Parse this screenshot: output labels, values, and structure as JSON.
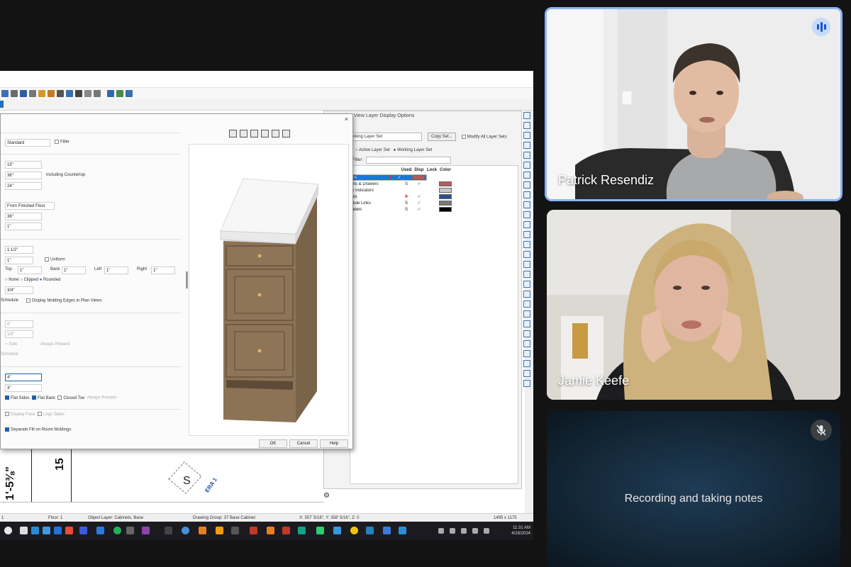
{
  "cabinet_dialog": {
    "close_glyph": "×",
    "rows": {
      "type_value": "Standard",
      "filler_label": "Filler",
      "width_value": "15\"",
      "height_value": "36\"",
      "height_label": "Including Countertop",
      "depth_value": "24\"",
      "floor_ref_value": "From Finished Floor",
      "f1_value": "36\"",
      "f2_value": "1\"",
      "toe_value": "1 1/2\"",
      "thick_value": "1\"",
      "unibox_label": "Uniform",
      "top_label": "Top",
      "top_value": "1\"",
      "back_label": "Back",
      "back_value": "1\"",
      "left_label": "Left",
      "left_value": "1\"",
      "right_label": "Right",
      "right_value": "1\"",
      "corner_none": "None",
      "corner_clipped": "Clipped",
      "corner_rounded": "Rounded",
      "radius_value": "3/4\"",
      "schedule_label": "Schedule",
      "molding_label": "Display Molding Edges in Plan Views",
      "g1_value": "0\"",
      "g2_value": "1/2\"",
      "side_label": "Side",
      "always_label": "Always Present",
      "schedule2_label": "Schedule",
      "h1_value": "4\"",
      "h2_value": "3\"",
      "flat_sides": "Flat Sides",
      "flat_back": "Flat Back",
      "closed_toe": "Closed Toe",
      "always2": "Always Present",
      "cb_face": "Display Face",
      "cb_legs": "Legs Sides",
      "separate": "Separate Fill on Room Moldings"
    },
    "buttons": {
      "ok": "OK",
      "cancel": "Cancel",
      "help": "Help"
    }
  },
  "layer_dialog": {
    "title": "Plan View Layer Display Options",
    "layer_set": "Working Layer Set",
    "copy_set": "Copy Set...",
    "modify_all": "Modify All Layer Sets",
    "active_set": "Active Layer Set",
    "working_set": "Working Layer Set",
    "filter_label": "Filter:",
    "columns": {
      "used": "Used",
      "disp": "Disp",
      "lock": "Lock",
      "color": "Color"
    },
    "rows": [
      {
        "name": "ls",
        "used": "✚",
        "disp": "✓",
        "color": "#b05a5a",
        "selected": true
      },
      {
        "name": "ets & Drawers",
        "used": "S",
        "disp": "✓",
        "color": "#b06060",
        "selected": false
      },
      {
        "name": "e Indicators",
        "used": "",
        "disp": "",
        "color": "#c8c8c8",
        "selected": false
      },
      {
        "name": "als",
        "used": "✚",
        "disp": "✓",
        "color": "#2a4f8a",
        "selected": false
      },
      {
        "name": "dule Links",
        "used": "S",
        "disp": "✓",
        "color": "#7a7a7a",
        "selected": false
      },
      {
        "name": "abels",
        "used": "S",
        "disp": "✓",
        "color": "#000000",
        "selected": false
      }
    ]
  },
  "plan": {
    "dimension": "1'-5⅜\"",
    "dimension2": "15",
    "symbol": "S",
    "tag": "ERA 1"
  },
  "status_bar": {
    "left": "1",
    "floor": "Floor: 1",
    "object": "Object Layer: Cabinets,  Base",
    "group": "Drawing Group: 37   Base Cabinet",
    "coords": "X: 357' 5/16\", Y: 358' 5/16\", Z: 0",
    "size": "1495 x 1175"
  },
  "taskbar": {
    "time": "11:31 AM",
    "date": "4/28/2024"
  },
  "participants": [
    {
      "name": "Patrick Resendiz",
      "speaking": true
    },
    {
      "name": "Jamie Keefe",
      "speaking": false
    }
  ],
  "notes_tile": {
    "message": "Recording and taking notes"
  },
  "colors": {
    "active_speaker_border": "#8ab4f8",
    "meet_bg": "#131313",
    "cabinet_wood": "#8c7356"
  }
}
